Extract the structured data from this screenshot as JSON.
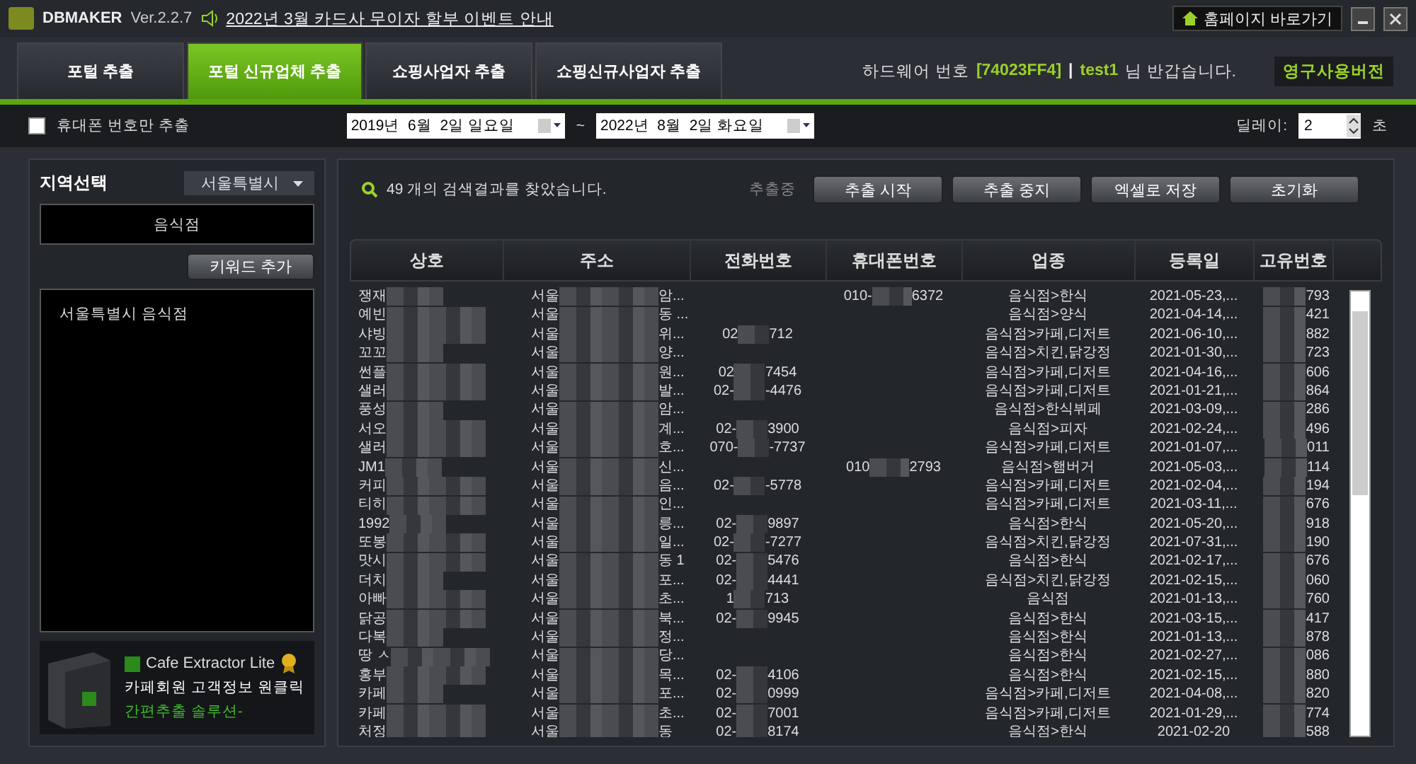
{
  "title_bar": {
    "app_name": "DBMAKER",
    "version": "Ver.2.2.7",
    "notice": "2022년 3월 카드사 무이자 할부 이벤트 안내",
    "home_button": "홈페이지 바로가기"
  },
  "tabs": [
    {
      "label": "포털 추출",
      "selected": false
    },
    {
      "label": "포털 신규업체 추출",
      "selected": true
    },
    {
      "label": "쇼핑사업자 추출",
      "selected": false
    },
    {
      "label": "쇼핑신규사업자 추출",
      "selected": false
    }
  ],
  "user_info": {
    "hw_label": "하드웨어 번호",
    "hw_id": "[74023FF4]",
    "separator": "|",
    "user": "test1",
    "greeting": "님 반갑습니다.",
    "license": "영구사용버전"
  },
  "options": {
    "mobile_only": {
      "label": "휴대폰 번호만 추출",
      "checked": false
    },
    "date_from": "2019년  6월  2일 일요일",
    "tilde": "~",
    "date_to": "2022년  8월  2일 화요일",
    "delay_label": "딜레이:",
    "delay_value": "2",
    "delay_unit": "초"
  },
  "left_panel": {
    "region_label": "지역선택",
    "region_value": "서울특별시",
    "keyword_value": "음식점",
    "add_keyword_button": "키워드 추가",
    "keywords": [
      {
        "label": "서울특별시 음식점",
        "selected": false
      }
    ],
    "ad": {
      "product": "Cafe Extractor Lite",
      "line1": "카페회원 고객정보 원클릭",
      "line2": "간편추출 솔루션-"
    }
  },
  "results": {
    "summary": "49 개의 검색결과를 찾았습니다.",
    "status": "추출중",
    "buttons": [
      "추출 시작",
      "추출 중지",
      "엑셀로 저장",
      "초기화"
    ]
  },
  "table": {
    "columns": [
      "상호",
      "주소",
      "전화번호",
      "휴대폰번호",
      "업종",
      "등록일",
      "고유번호"
    ],
    "rows": [
      {
        "name": "쟁재",
        "addr": {
          "head": "서울",
          "tail": "암..."
        },
        "mobile": {
          "head": "010-",
          "tail": "6372"
        },
        "category": "음식점>한식",
        "date": "2021-05-23,...",
        "id": "793"
      },
      {
        "name": "예빈",
        "addr": {
          "head": "서울",
          "tail": "동 ..."
        },
        "category": "음식점>양식",
        "date": "2021-04-14,...",
        "id": "421"
      },
      {
        "name": "샤빙",
        "addr": {
          "head": "서울",
          "tail": "위..."
        },
        "phone": {
          "head": "02",
          "tail": "712"
        },
        "category": "음식점>카페,디저트",
        "date": "2021-06-10,...",
        "id": "882"
      },
      {
        "name": "꼬꼬",
        "addr": {
          "head": "서울",
          "tail": "양..."
        },
        "category": "음식점>치킨,닭강정",
        "date": "2021-01-30,...",
        "id": "723"
      },
      {
        "name": "썬플",
        "addr": {
          "head": "서울",
          "tail": "원..."
        },
        "phone": {
          "head": "02",
          "tail": "7454"
        },
        "category": "음식점>카페,디저트",
        "date": "2021-04-16,...",
        "id": "606"
      },
      {
        "name": "샐러",
        "addr": {
          "head": "서울",
          "tail": "발..."
        },
        "phone": {
          "head": "02-",
          "tail": "-4476"
        },
        "category": "음식점>카페,디저트",
        "date": "2021-01-21,...",
        "id": "864"
      },
      {
        "name": "풍성",
        "addr": {
          "head": "서울",
          "tail": "암..."
        },
        "category": "음식점>한식뷔페",
        "date": "2021-03-09,...",
        "id": "286"
      },
      {
        "name": "서오",
        "addr": {
          "head": "서울",
          "tail": "계..."
        },
        "phone": {
          "head": "02-",
          "tail": "3900"
        },
        "category": "음식점>피자",
        "date": "2021-02-24,...",
        "id": "496"
      },
      {
        "name": "샐러",
        "addr": {
          "head": "서울",
          "tail": "호..."
        },
        "phone": {
          "head": "070-",
          "tail": "-7737"
        },
        "category": "음식점>카페,디저트",
        "date": "2021-01-07,...",
        "id": "011"
      },
      {
        "name": "JM1",
        "addr": {
          "head": "서울",
          "tail": "신..."
        },
        "mobile": {
          "head": "010",
          "tail": "2793"
        },
        "category": "음식점>햄버거",
        "date": "2021-05-03,...",
        "id": "114"
      },
      {
        "name": "커피",
        "addr": {
          "head": "서울",
          "tail": "음..."
        },
        "phone": {
          "head": "02-",
          "tail": "-5778"
        },
        "category": "음식점>카페,디저트",
        "date": "2021-02-04,...",
        "id": "194"
      },
      {
        "name": "티히",
        "addr": {
          "head": "서울",
          "tail": "인..."
        },
        "category": "음식점>카페,디저트",
        "date": "2021-03-11,...",
        "id": "676"
      },
      {
        "name": "1992",
        "addr": {
          "head": "서울",
          "tail": "릉..."
        },
        "phone": {
          "head": "02-",
          "tail": "9897"
        },
        "category": "음식점>한식",
        "date": "2021-05-20,...",
        "id": "918"
      },
      {
        "name": "또봉",
        "addr": {
          "head": "서울",
          "tail": "일..."
        },
        "phone": {
          "head": "02-",
          "tail": "-7277"
        },
        "category": "음식점>치킨,닭강정",
        "date": "2021-07-31,...",
        "id": "190"
      },
      {
        "name": "맛시",
        "addr": {
          "head": "서울",
          "tail": "동 1"
        },
        "phone": {
          "head": "02-",
          "tail": "5476"
        },
        "category": "음식점>한식",
        "date": "2021-02-17,...",
        "id": "676"
      },
      {
        "name": "더치",
        "addr": {
          "head": "서울",
          "tail": "포..."
        },
        "phone": {
          "head": "02-",
          "tail": "4441"
        },
        "category": "음식점>치킨,닭강정",
        "date": "2021-02-15,...",
        "id": "060"
      },
      {
        "name": "아빠",
        "addr": {
          "head": "서울",
          "tail": "초..."
        },
        "phone": {
          "head": "1",
          "tail": "713"
        },
        "category": "음식점",
        "date": "2021-01-13,...",
        "id": "760"
      },
      {
        "name": "닭공",
        "addr": {
          "head": "서울",
          "tail": "북..."
        },
        "phone": {
          "head": "02-",
          "tail": "9945"
        },
        "category": "음식점>한식",
        "date": "2021-03-15,...",
        "id": "417"
      },
      {
        "name": "다복",
        "addr": {
          "head": "서울",
          "tail": "정..."
        },
        "category": "음식점>한식",
        "date": "2021-01-13,...",
        "id": "878"
      },
      {
        "name": "땅 ㅅ",
        "addr": {
          "head": "서울",
          "tail": "당..."
        },
        "category": "음식점>한식",
        "date": "2021-02-27,...",
        "id": "086"
      },
      {
        "name": "홍부",
        "addr": {
          "head": "서울",
          "tail": "목..."
        },
        "phone": {
          "head": "02-",
          "tail": "4106"
        },
        "category": "음식점>한식",
        "date": "2021-02-15,...",
        "id": "880"
      },
      {
        "name": "카페",
        "addr": {
          "head": "서울",
          "tail": "포..."
        },
        "phone": {
          "head": "02-",
          "tail": "0999"
        },
        "category": "음식점>카페,디저트",
        "date": "2021-04-08,...",
        "id": "820"
      },
      {
        "name": "카페",
        "addr": {
          "head": "서울",
          "tail": "초..."
        },
        "phone": {
          "head": "02-",
          "tail": "7001"
        },
        "category": "음식점>카페,디저트",
        "date": "2021-01-29,...",
        "id": "774"
      },
      {
        "name": "처정",
        "addr": {
          "head": "서울",
          "tail": "동"
        },
        "phone": {
          "head": "02-",
          "tail": "8174"
        },
        "category": "음식점>한식",
        "date": "2021-02-20",
        "id": "588"
      }
    ]
  }
}
